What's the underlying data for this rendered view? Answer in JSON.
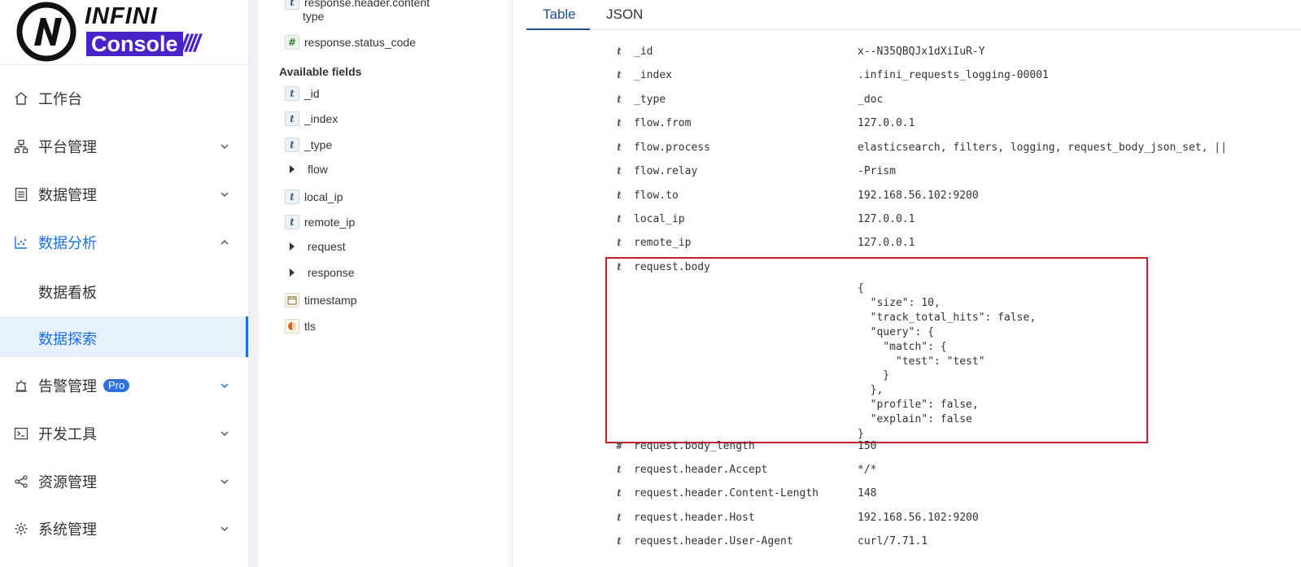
{
  "logo": {
    "line1": "INFINI",
    "line2": "Console",
    "slashes": "////"
  },
  "sidebar": {
    "items": [
      {
        "label": "工作台",
        "icon": "home-icon"
      },
      {
        "label": "平台管理",
        "icon": "sitemap-icon"
      },
      {
        "label": "数据管理",
        "icon": "database-list-icon"
      },
      {
        "label": "数据分析",
        "icon": "chart-icon"
      },
      {
        "label": "数据看板"
      },
      {
        "label": "数据探索"
      },
      {
        "label": "告警管理",
        "icon": "alarm-icon",
        "badge": "Pro"
      },
      {
        "label": "开发工具",
        "icon": "terminal-icon"
      },
      {
        "label": "资源管理",
        "icon": "share-icon"
      },
      {
        "label": "系统管理",
        "icon": "gear-icon"
      }
    ]
  },
  "field_panel": {
    "selected_partial": [
      "response.header.content",
      "type",
      "response.status_code"
    ],
    "available_title": "Available fields",
    "fields": [
      "_id",
      "_index",
      "_type",
      "flow",
      "local_ip",
      "remote_ip",
      "request",
      "response",
      "timestamp",
      "tls"
    ]
  },
  "tabs": {
    "table": "Table",
    "json": "JSON"
  },
  "document": {
    "rows_top": [
      {
        "type": "t",
        "name": "_id",
        "value": "x--N35QBQJx1dXiIuR-Y"
      },
      {
        "type": "t",
        "name": "_index",
        "value": ".infini_requests_logging-00001"
      },
      {
        "type": "t",
        "name": "_type",
        "value": "_doc"
      },
      {
        "type": "t",
        "name": "flow.from",
        "value": "127.0.0.1"
      },
      {
        "type": "t",
        "name": "flow.process",
        "value": "elasticsearch, filters, logging, request_body_json_set, ||"
      },
      {
        "type": "t",
        "name": "flow.relay",
        "value": "-Prism"
      },
      {
        "type": "t",
        "name": "flow.to",
        "value": "192.168.56.102:9200"
      },
      {
        "type": "t",
        "name": "local_ip",
        "value": "127.0.0.1"
      },
      {
        "type": "t",
        "name": "remote_ip",
        "value": "127.0.0.1"
      }
    ],
    "body_row": {
      "type": "t",
      "name": "request.body",
      "json_lines": "{\n  \"size\": 10,\n  \"track_total_hits\": false,\n  \"query\": {\n    \"match\": {\n      \"test\": \"test\"\n    }\n  },\n  \"profile\": false,\n  \"explain\": false\n}"
    },
    "rows_bottom": [
      {
        "type": "#",
        "name": "request.body_length",
        "value": "150"
      },
      {
        "type": "t",
        "name": "request.header.Accept",
        "value": "*/*"
      },
      {
        "type": "t",
        "name": "request.header.Content-Length",
        "value": "148"
      },
      {
        "type": "t",
        "name": "request.header.Host",
        "value": "192.168.56.102:9200"
      },
      {
        "type": "t",
        "name": "request.header.User-Agent",
        "value": "curl/7.71.1"
      }
    ]
  },
  "colors": {
    "accent": "#1e6fd9",
    "brand": "#4a22c9",
    "highlight_border": "#c4202a"
  }
}
